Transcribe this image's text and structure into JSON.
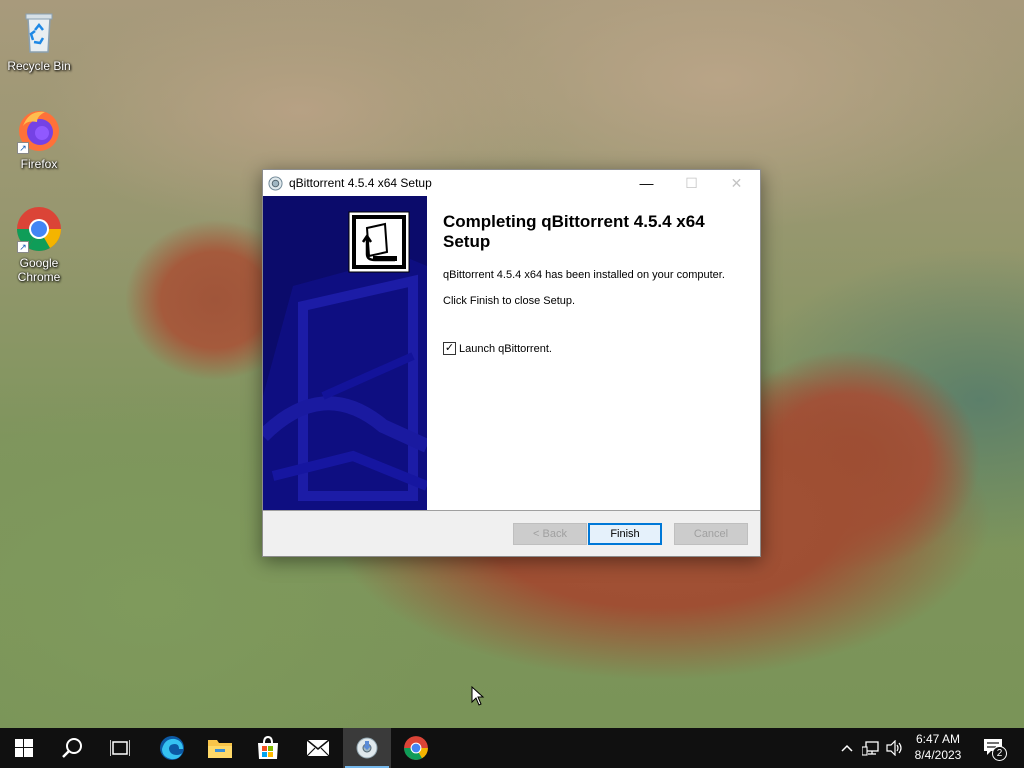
{
  "desktop": {
    "icons": [
      {
        "label": "Recycle Bin",
        "icon": "recycle-bin-icon"
      },
      {
        "label": "Firefox",
        "icon": "firefox-icon"
      },
      {
        "label": "Google Chrome",
        "icon": "chrome-icon"
      }
    ]
  },
  "dialog": {
    "title": "qBittorrent 4.5.4 x64 Setup",
    "heading": "Completing qBittorrent 4.5.4 x64 Setup",
    "installed_text": "qBittorrent 4.5.4 x64 has been installed on your computer.",
    "close_text": "Click Finish to close Setup.",
    "checkbox": {
      "label": "Launch qBittorrent.",
      "checked": true
    },
    "buttons": {
      "back": "< Back",
      "finish": "Finish",
      "cancel": "Cancel"
    },
    "banner_color": "#0b0b6b"
  },
  "taskbar": {
    "items": [
      "start-icon",
      "search-icon",
      "task-view-icon",
      "edge-icon",
      "file-explorer-icon",
      "store-icon",
      "mail-icon",
      "qbittorrent-setup-icon",
      "chrome-icon"
    ],
    "active_item": "qbittorrent-setup-icon",
    "tray": {
      "time": "6:47 AM",
      "date": "8/4/2023",
      "notification_count": "2"
    }
  }
}
